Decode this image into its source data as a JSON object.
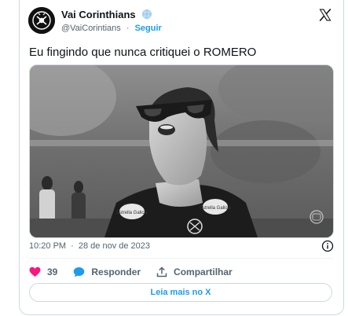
{
  "author": {
    "name": "Vai Corinthians",
    "handle": "@VaiCorintians",
    "separator": "·",
    "follow_label": "Seguir"
  },
  "tweet": {
    "text": "Eu fingindo que nunca critiquei o ROMERO",
    "time": "10:20 PM",
    "meta_separator": "·",
    "date": "28 de nov de 2023"
  },
  "media": {
    "kind": "black-and-white photo of a man wearing sunglasses looking upward",
    "jersey_sponsor": "Estrella Galicia",
    "jersey_sponsor_right": "Estrella Galicia"
  },
  "actions": {
    "likes": "39",
    "reply_label": "Responder",
    "share_label": "Compartilhar"
  },
  "read_more_label": "Leia mais no X",
  "colors": {
    "accent": "#1d9bf0",
    "like": "#f91880",
    "text": "#0f1419",
    "secondary": "#536471",
    "border": "#cfd9de"
  },
  "icons": [
    "club-crest-icon",
    "verified-badge-icon",
    "x-logo-icon",
    "info-icon",
    "heart-icon",
    "reply-bubble-icon",
    "share-icon"
  ]
}
